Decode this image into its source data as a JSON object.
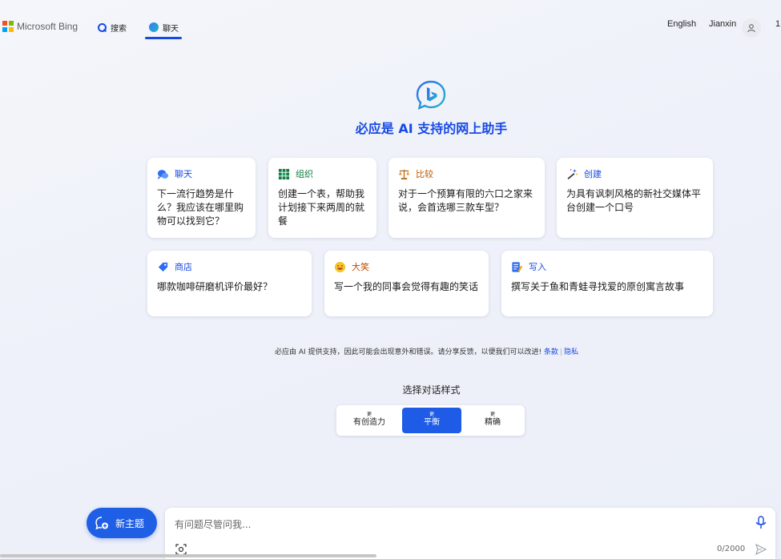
{
  "header": {
    "brand": "Microsoft Bing",
    "tabs": [
      {
        "label": "搜索"
      },
      {
        "label": "聊天"
      }
    ],
    "language": "English",
    "user": "Jianxin",
    "reward_count": "1"
  },
  "hero": {
    "title": "必应是 AI 支持的网上助手"
  },
  "cards": [
    {
      "label": "聊天",
      "icon": "chat-bubbles-icon",
      "color": "#174ae4",
      "text": "下一流行趋势是什么？我应该在哪里购物可以找到它？"
    },
    {
      "label": "组织",
      "icon": "grid-table-icon",
      "color": "#107c41",
      "text": "创建一个表，帮助我计划接下来两周的就餐"
    },
    {
      "label": "比较",
      "icon": "balance-scale-icon",
      "color": "#c05a00",
      "text": "对于一个预算有限的六口之家来说，会首选哪三款车型？"
    },
    {
      "label": "创建",
      "icon": "magic-wand-icon",
      "color": "#174ae4",
      "text": "为具有讽刺风格的新社交媒体平台创建一个口号"
    },
    {
      "label": "商店",
      "icon": "price-tag-icon",
      "color": "#174ae4",
      "text": "哪款咖啡研磨机评价最好？"
    },
    {
      "label": "大笑",
      "icon": "laughing-face-icon",
      "color": "#c04a00",
      "text": "写一个我的同事会觉得有趣的笑话"
    },
    {
      "label": "写入",
      "icon": "write-note-icon",
      "color": "#174ae4",
      "text": "撰写关于鱼和青蛙寻找爱的原创寓言故事"
    }
  ],
  "disclaimer": {
    "text": "必应由 AI 提供支持，因此可能会出现意外和错误。请分享反馈，以便我们可以改进!",
    "terms": "条款",
    "privacy": "隐私"
  },
  "conversation_style": {
    "title": "选择对话样式",
    "options": [
      {
        "small": "更",
        "label": "有创造力",
        "active": false
      },
      {
        "small": "更",
        "label": "平衡",
        "active": true
      },
      {
        "small": "更",
        "label": "精确",
        "active": false
      }
    ]
  },
  "composer": {
    "new_topic": "新主题",
    "placeholder": "有问题尽管问我...",
    "counter": "0/2000"
  },
  "colors": {
    "accent": "#174ae4",
    "active_tone": "#1e5ce8"
  }
}
